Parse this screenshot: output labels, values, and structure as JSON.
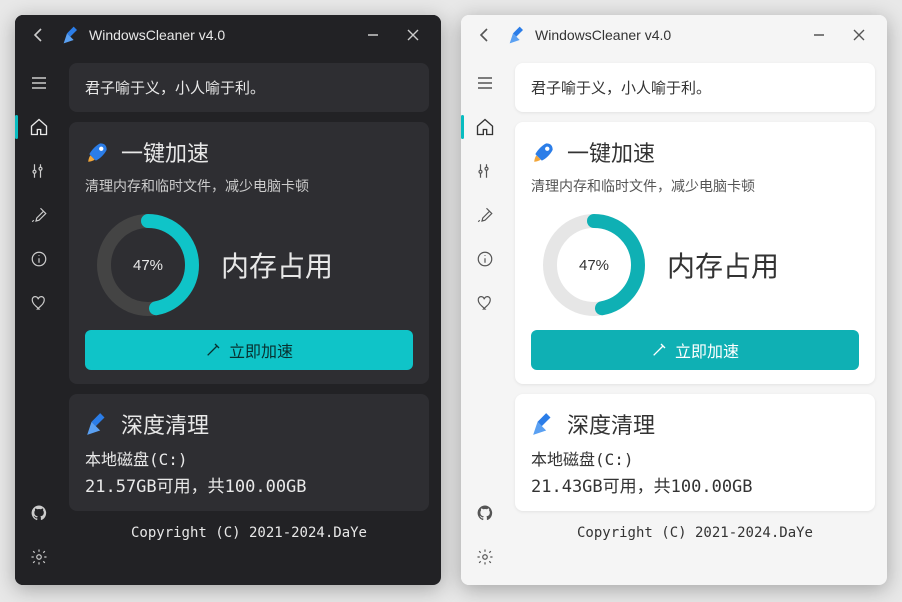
{
  "app": {
    "title": "WindowsCleaner v4.0"
  },
  "quote": "君子喻于义，小人喻于利。",
  "boost": {
    "title": "一键加速",
    "subtitle": "清理内存和临时文件，减少电脑卡顿",
    "percent_label": "47%",
    "percent_value": 47,
    "gauge_label": "内存占用",
    "button": "立即加速"
  },
  "clean": {
    "title": "深度清理",
    "disk_label_dark": "本地磁盘(C:)",
    "disk_stats_dark": "21.57GB可用，共100.00GB",
    "disk_label_light": "本地磁盘(C:)",
    "disk_stats_light": "21.43GB可用，共100.00GB"
  },
  "copyright": "Copyright (C) 2021-2024.DaYe",
  "colors": {
    "accent": "#0fc4c8",
    "dark_bg": "#222225",
    "dark_card": "#2e2e32",
    "light_bg": "#f5f5f5",
    "light_card": "#ffffff"
  },
  "icons": {
    "broom": "broom-icon",
    "rocket": "rocket-icon"
  }
}
